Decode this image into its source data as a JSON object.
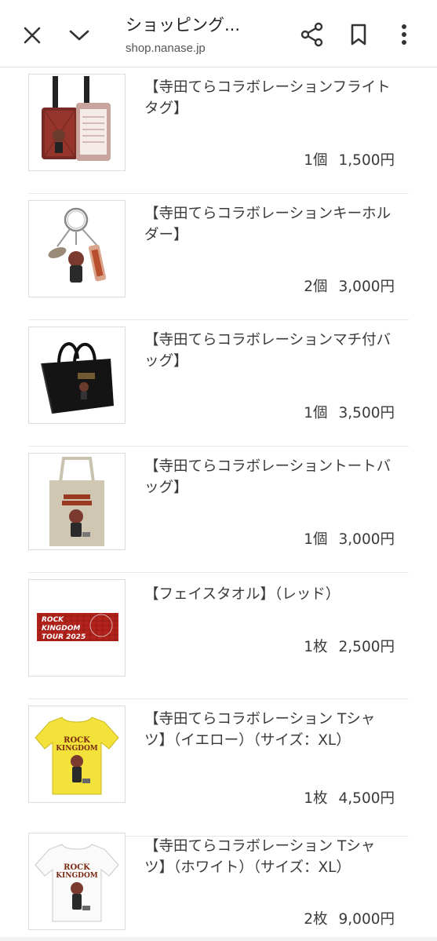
{
  "topbar": {
    "title": "ショッピング...",
    "url": "shop.nanase.jp",
    "icons": [
      "close-icon",
      "chevron-down-icon",
      "share-icon",
      "bookmark-icon",
      "more-vert-icon"
    ]
  },
  "items": [
    {
      "name": "【寺田てらコラボレーションフライトタグ】",
      "qty": "1個",
      "price": "1,500円",
      "thumb": "flight-tag"
    },
    {
      "name": "【寺田てらコラボレーションキーホルダー】",
      "qty": "2個",
      "price": "3,000円",
      "thumb": "keyholder"
    },
    {
      "name": "【寺田てらコラボレーションマチ付バッグ】",
      "qty": "1個",
      "price": "3,500円",
      "thumb": "black-bag"
    },
    {
      "name": "【寺田てらコラボレーショントートバッグ】",
      "qty": "1個",
      "price": "3,000円",
      "thumb": "tote-bag"
    },
    {
      "name": "【フェイスタオル】（レッド）",
      "qty": "1枚",
      "price": "2,500円",
      "thumb": "face-towel",
      "thumb_text": [
        "ROCK",
        "KINGDOM",
        "TOUR 2025"
      ]
    },
    {
      "name": "【寺田てらコラボレーション Tシャツ】（イエロー）（サイズ：XL）",
      "qty": "1枚",
      "price": "4,500円",
      "thumb": "tshirt-yellow",
      "thumb_text": [
        "ROCK",
        "KINGDOM"
      ]
    },
    {
      "name": "【寺田てらコラボレーション Tシャツ】（ホワイト）（サイズ：XL）",
      "qty": "2枚",
      "price": "9,000円",
      "thumb": "tshirt-white",
      "thumb_text": [
        "ROCK",
        "KINGDOM"
      ]
    }
  ]
}
